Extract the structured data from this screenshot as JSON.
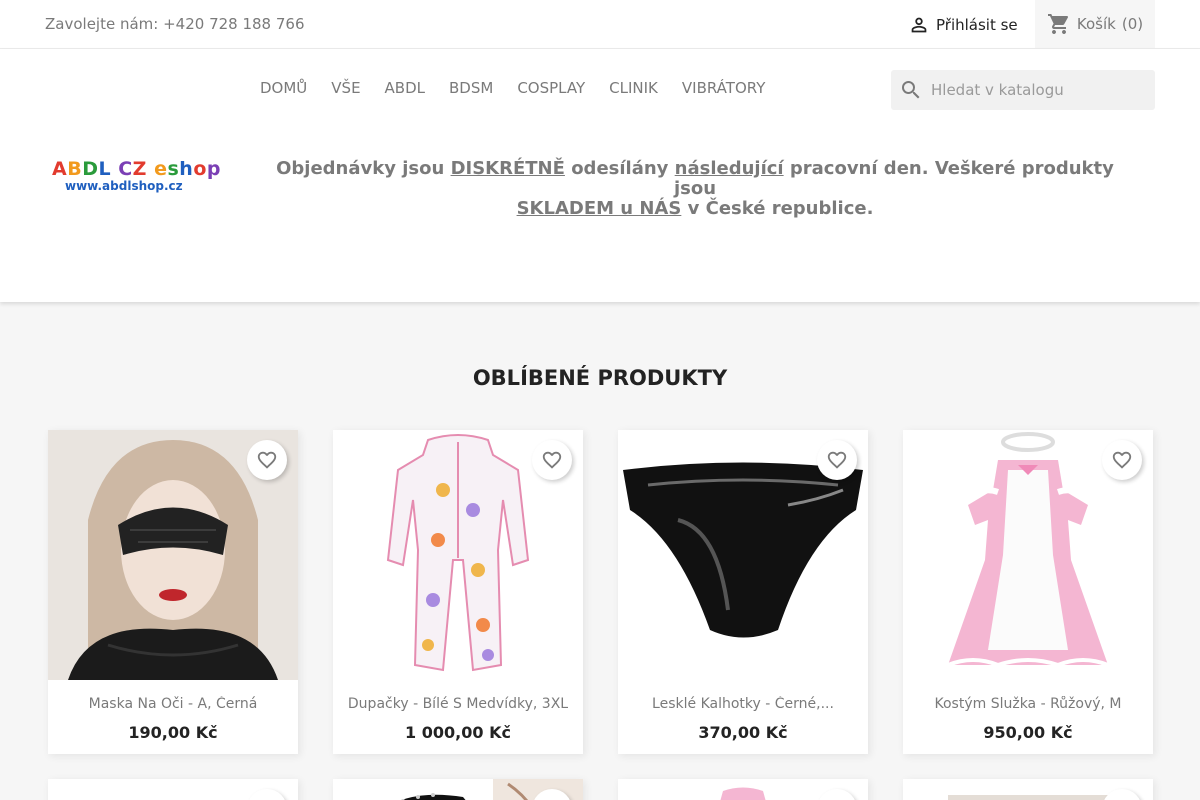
{
  "topbar": {
    "contact": "Zavolejte nám: +420 728 188 766",
    "signin_label": "Přihlásit se",
    "cart_label": "Košík",
    "cart_count": "(0)"
  },
  "menu": [
    "DOMŮ",
    "VŠE",
    "ABDL",
    "BDSM",
    "COSPLAY",
    "CLINIK",
    "VIBRÁTORY"
  ],
  "search": {
    "placeholder": "Hledat v katalogu"
  },
  "logo": {
    "letters": [
      "A",
      "B",
      "D",
      "L",
      "C",
      "Z",
      "e",
      "s",
      "h",
      "o",
      "p"
    ],
    "url": "www.abdlshop.cz"
  },
  "notice": {
    "p1": "Objednávky jsou ",
    "u1": "DISKRÉTNĚ",
    "p2": " odesílány ",
    "u2": "následující",
    "p3": " pracovní den. Veškeré produkty jsou ",
    "u3": "SKLADEM u NÁS",
    "p4": " v České republice."
  },
  "section_title": "OBLÍBENÉ PRODUKTY",
  "products": [
    {
      "name": "Maska Na Oči - A, Černá",
      "price": "190,00 Kč"
    },
    {
      "name": "Dupačky - Bílé S Medvídky, 3XL",
      "price": "1 000,00 Kč"
    },
    {
      "name": "Lesklé Kalhotky - Černé,...",
      "price": "370,00 Kč"
    },
    {
      "name": "Kostým Služka - Růžový, M",
      "price": "950,00 Kč"
    }
  ],
  "colors": {
    "accent": "#24b9d7",
    "text": "#232323",
    "muted": "#7a7a7a",
    "background": "#f6f6f6"
  }
}
